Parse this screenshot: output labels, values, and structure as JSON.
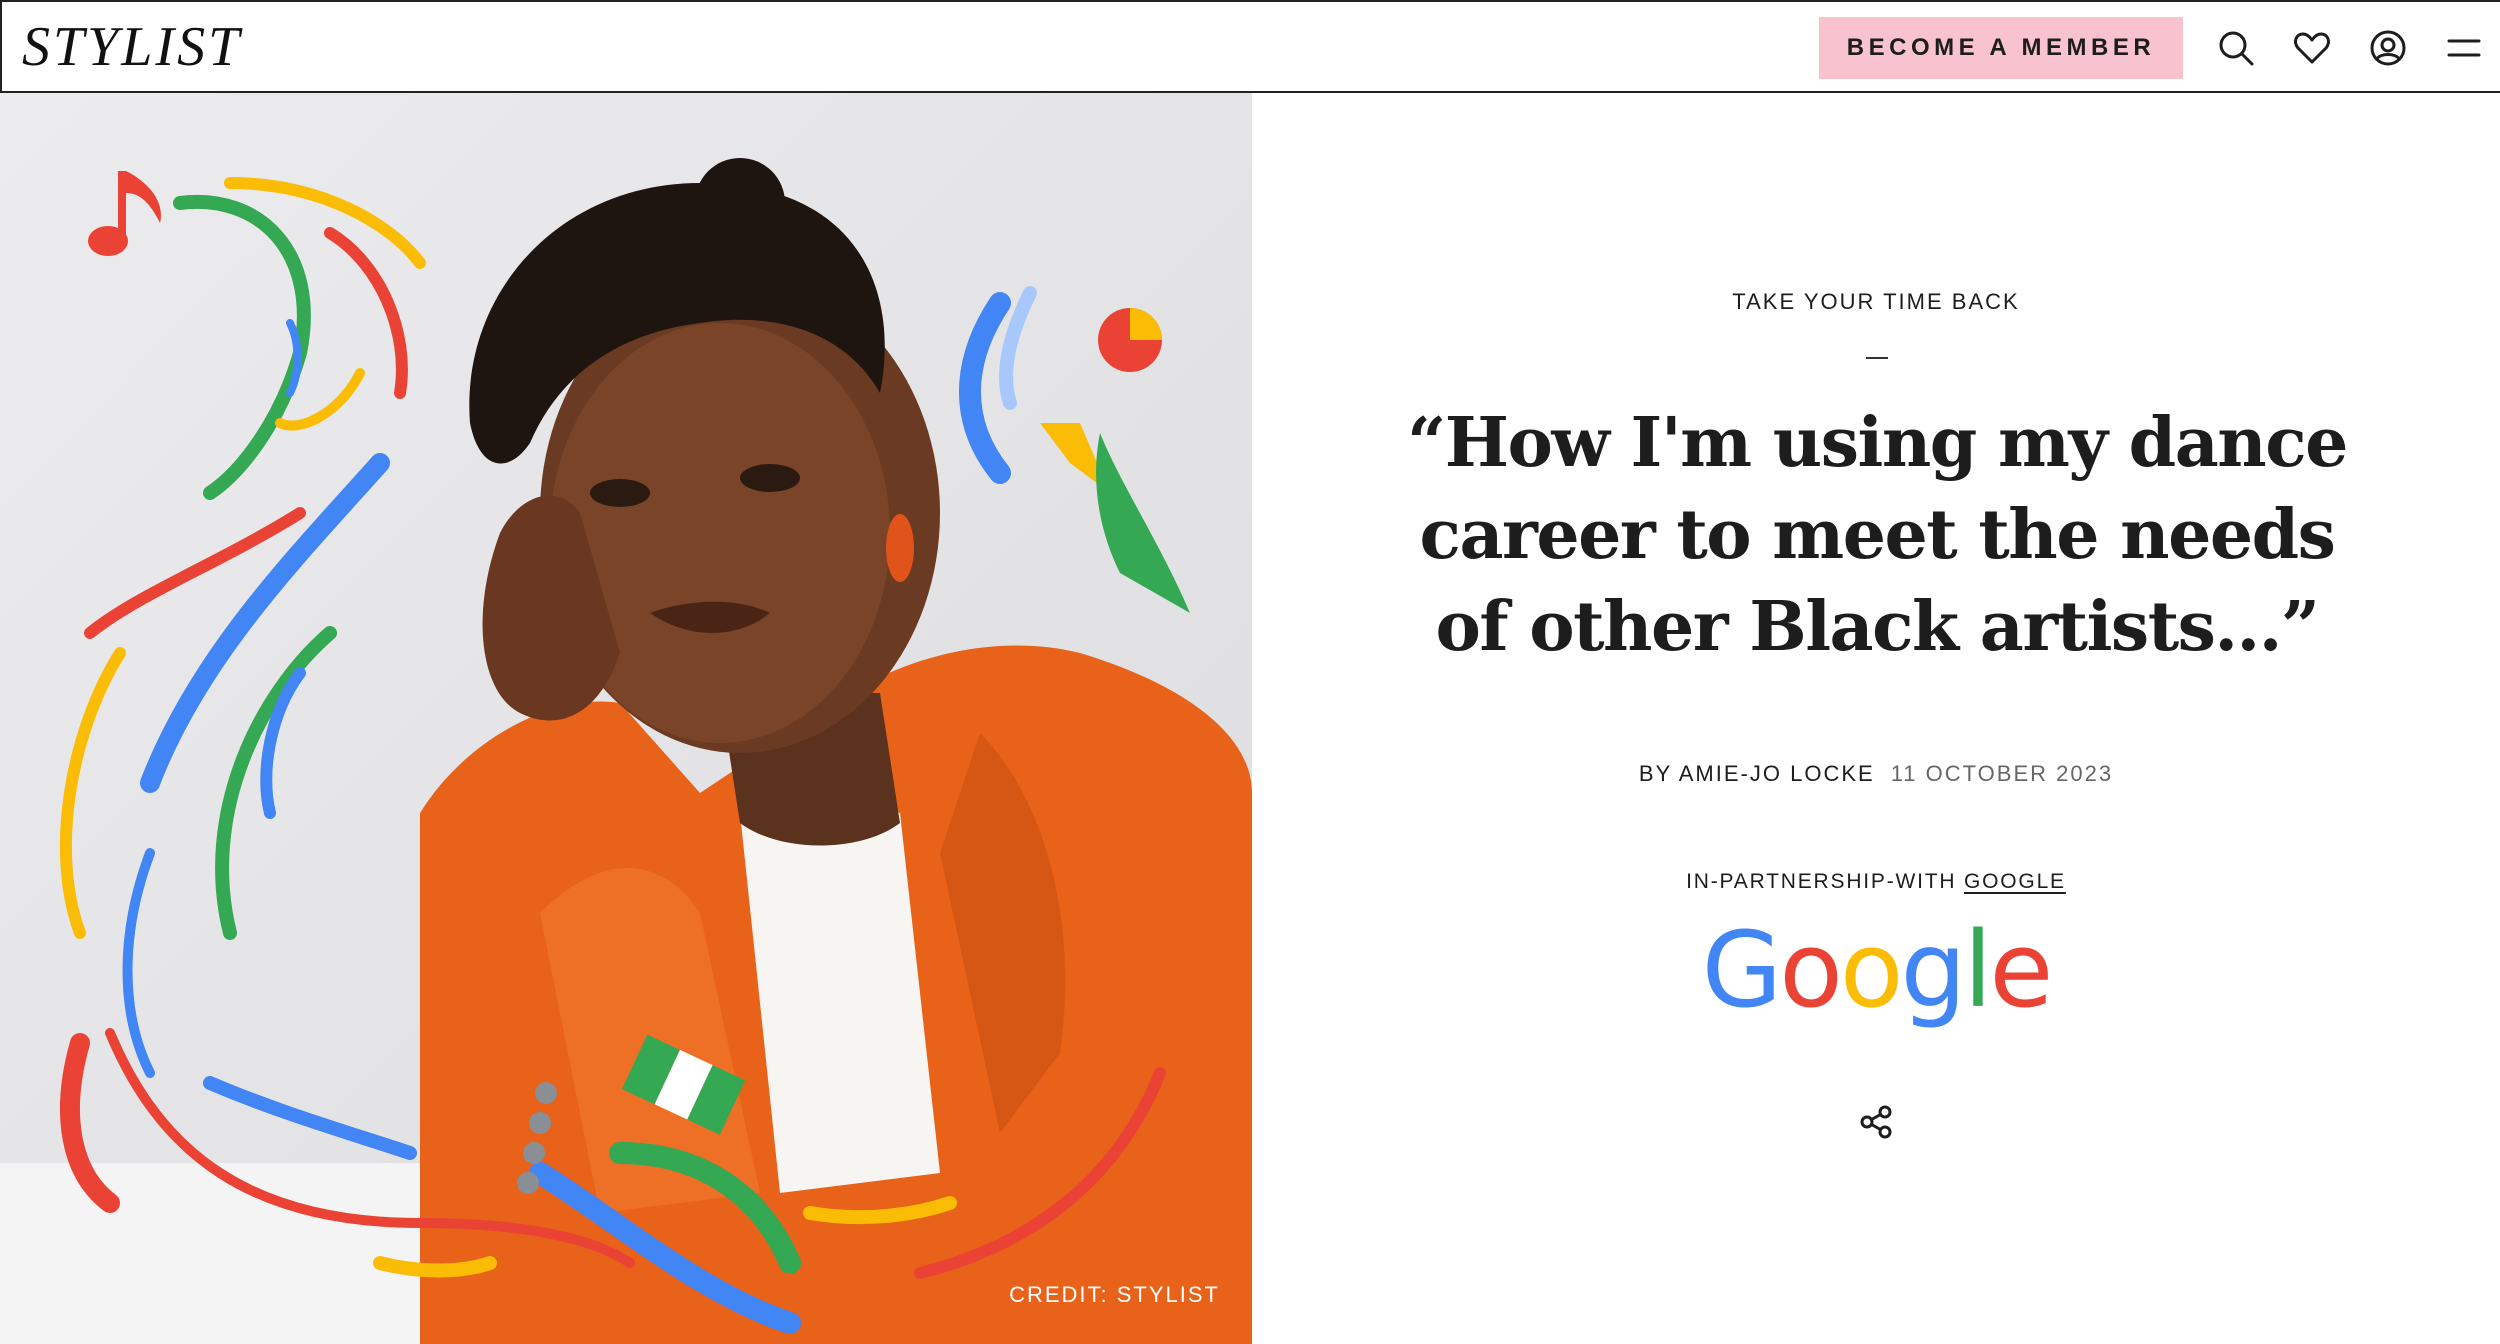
{
  "header": {
    "logo": "STYLIST",
    "member_button": "BECOME A MEMBER"
  },
  "hero": {
    "credit": "CREDIT: STYLIST"
  },
  "article": {
    "kicker": "TAKE YOUR TIME BACK",
    "headline": "“How I'm using my dance career to meet the needs of other Black artists...”",
    "author": "BY AMIE-JO LOCKE",
    "date": "11 OCTOBER 2023",
    "partner_prefix": "IN-PARTNERSHIP-WITH",
    "partner_name": "GOOGLE",
    "partner_logo": {
      "letters": [
        "G",
        "o",
        "o",
        "g",
        "l",
        "e"
      ],
      "colors": [
        "#4285F4",
        "#EA4335",
        "#FBBC05",
        "#4285F4",
        "#34A853",
        "#EA4335"
      ]
    }
  },
  "icons": [
    "search-icon",
    "heart-icon",
    "account-icon",
    "menu-icon",
    "share-icon"
  ],
  "colors": {
    "member_button_bg": "#f8c3cf",
    "jacket_orange": "#e8621a",
    "google_blue": "#4285F4",
    "google_red": "#EA4335",
    "google_yellow": "#FBBC05",
    "google_green": "#34A853"
  }
}
